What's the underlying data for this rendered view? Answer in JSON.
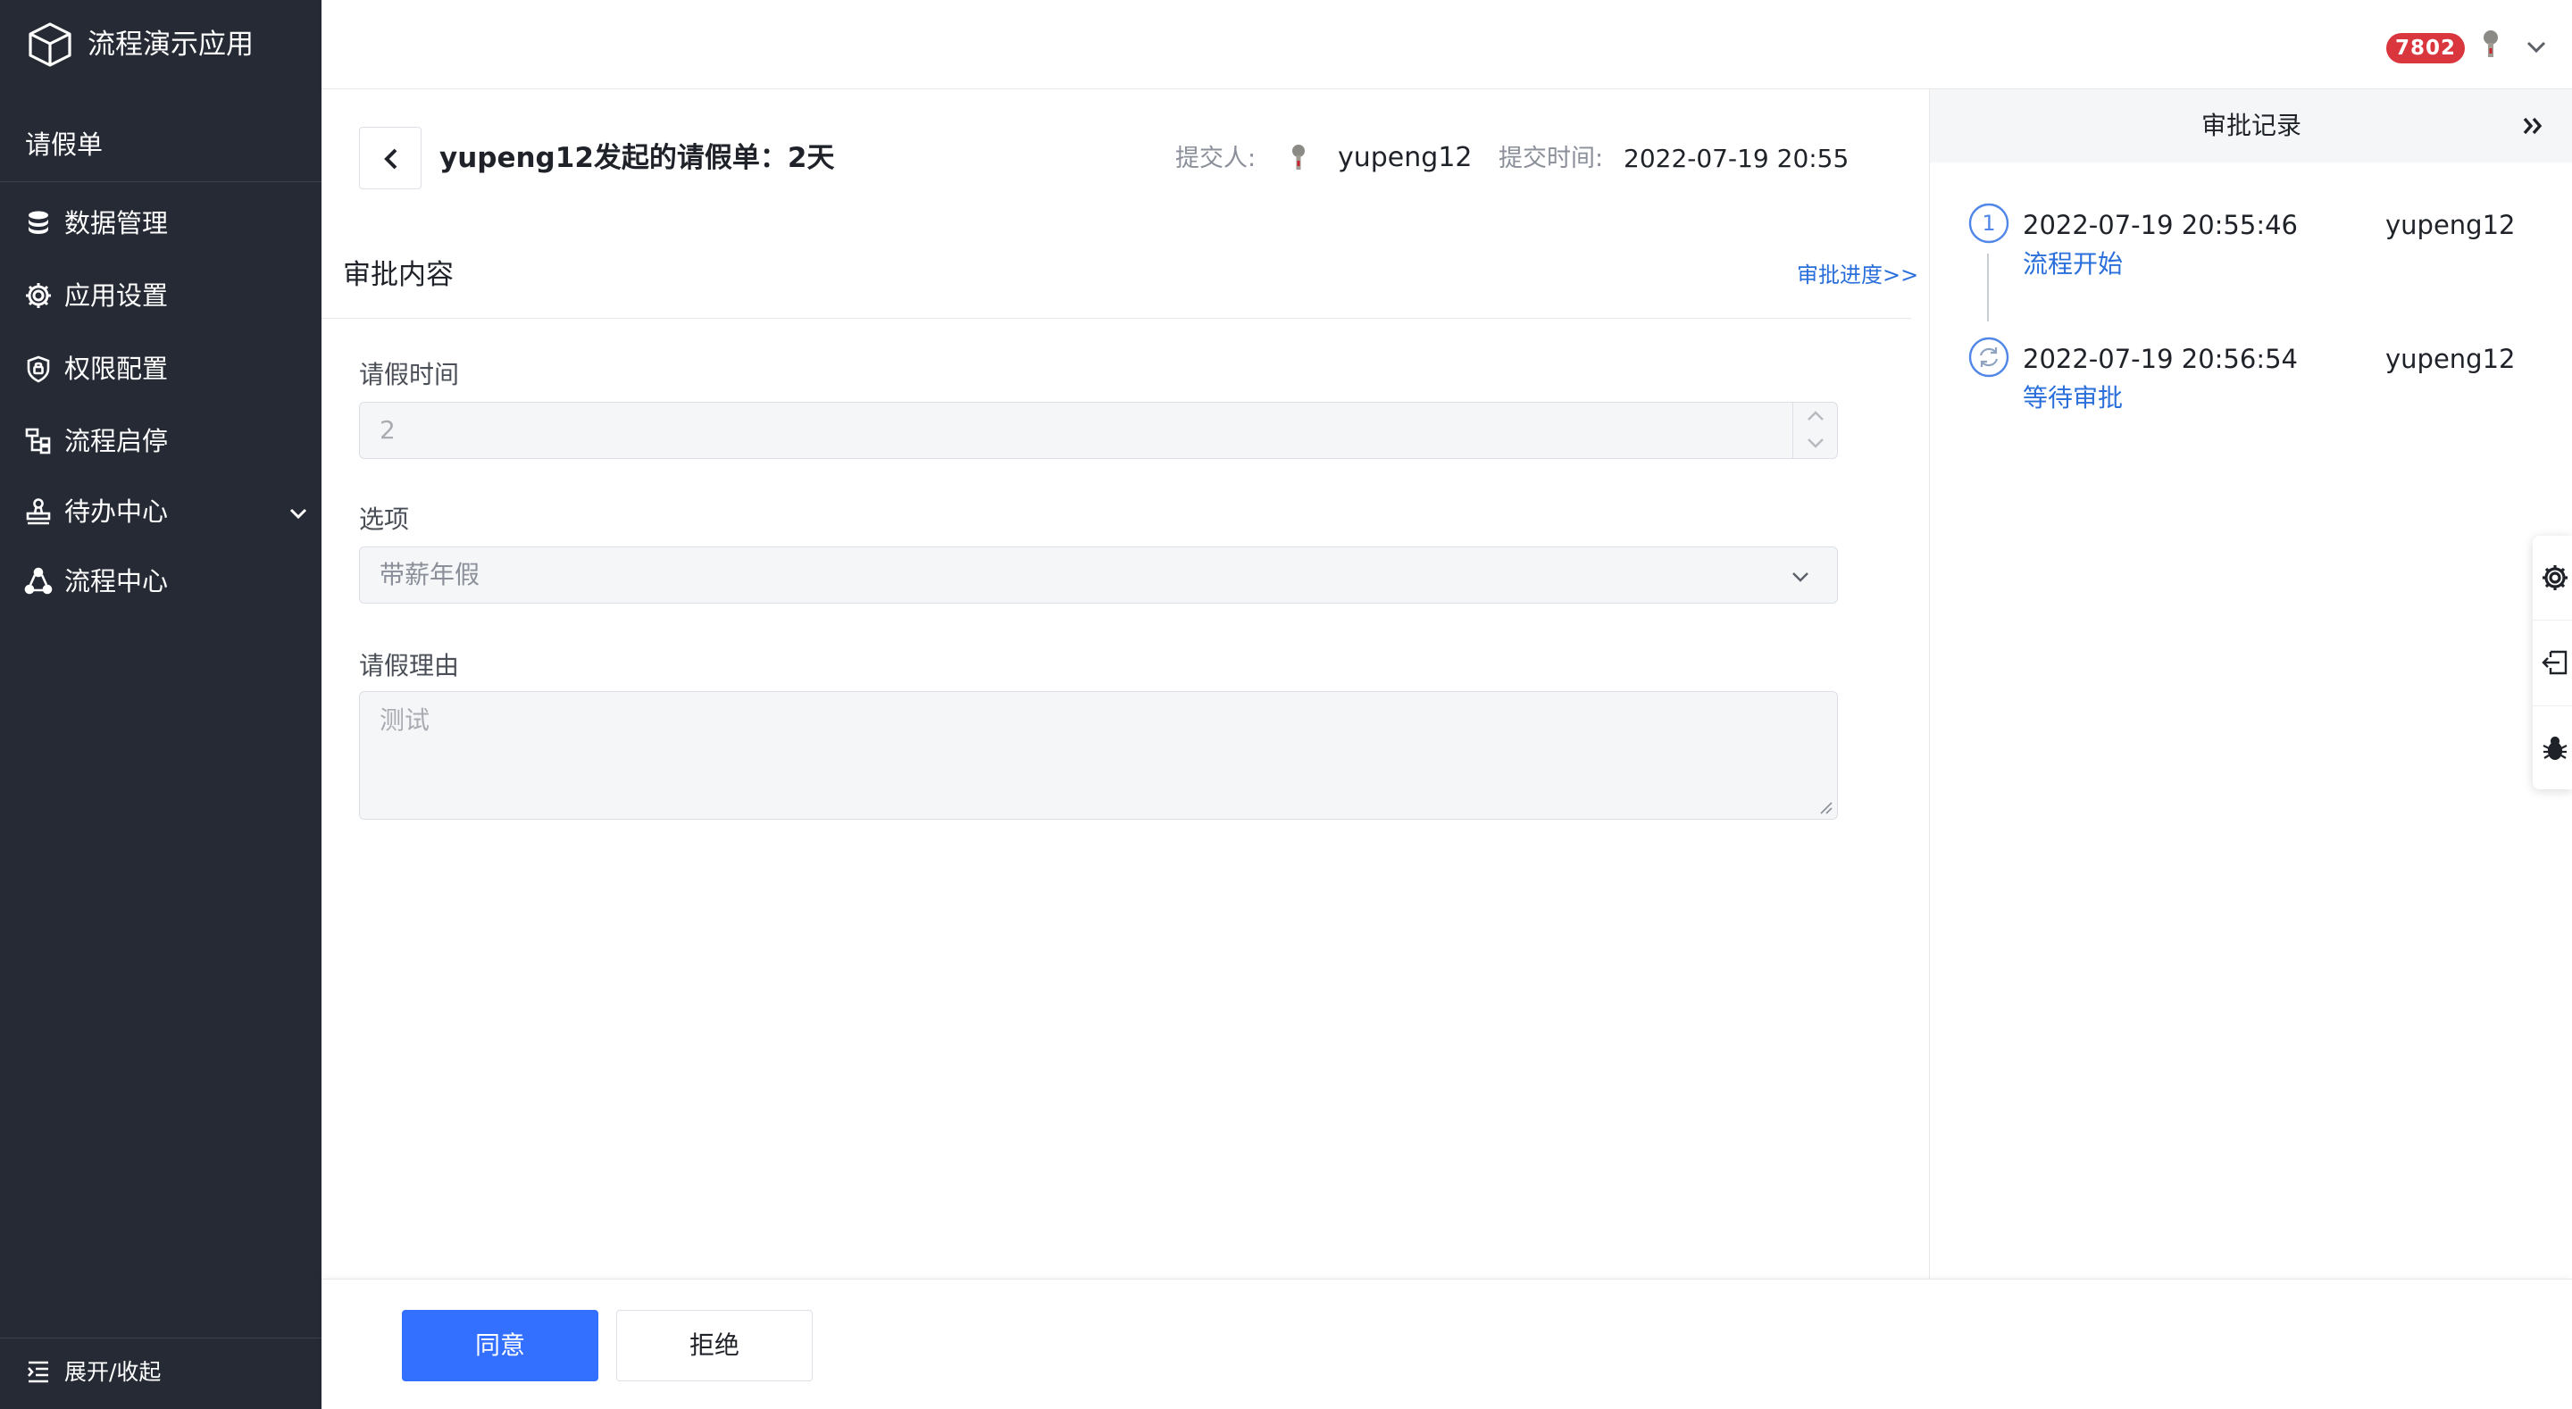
{
  "app": {
    "title": "流程演示应用",
    "icon": "cube-icon"
  },
  "sidebar": {
    "section": "请假单",
    "items": [
      {
        "label": "数据管理",
        "icon": "database-icon"
      },
      {
        "label": "应用设置",
        "icon": "gear-icon"
      },
      {
        "label": "权限配置",
        "icon": "shield-icon"
      },
      {
        "label": "流程启停",
        "icon": "flow-icon"
      },
      {
        "label": "待办中心",
        "icon": "stamp-icon",
        "expandable": true
      },
      {
        "label": "流程中心",
        "icon": "network-icon"
      }
    ],
    "footer": {
      "label": "展开/收起",
      "icon": "indent-icon"
    }
  },
  "topbar": {
    "badge": "7802",
    "badge_color": "#d9363e",
    "avatar_icon": "user-avatar-icon",
    "menu_icon": "chevron-down-icon"
  },
  "main": {
    "title": "yupeng12发起的请假单：2天",
    "meta": {
      "submitter_label": "提交人:",
      "submitter": "yupeng12",
      "time_label": "提交时间:",
      "time": "2022-07-19 20:55"
    },
    "section_title": "审批内容",
    "section_link": "审批进度>>",
    "fields": {
      "leave_time": {
        "label": "请假时间",
        "value": "2"
      },
      "option": {
        "label": "选项",
        "value": "带薪年假"
      },
      "reason": {
        "label": "请假理由",
        "value": "测试"
      }
    }
  },
  "record_panel": {
    "title": "审批记录",
    "entries": [
      {
        "step": "1",
        "time": "2022-07-19 20:55:46",
        "user": "yupeng12",
        "status": "流程开始"
      },
      {
        "time": "2022-07-19 20:56:54",
        "user": "yupeng12",
        "status": "等待审批",
        "icon": "refresh-icon"
      }
    ]
  },
  "side_tools": [
    {
      "icon": "gear-icon"
    },
    {
      "icon": "exit-icon"
    },
    {
      "icon": "bug-icon"
    }
  ],
  "actions": {
    "approve": "同意",
    "reject": "拒绝"
  },
  "colors": {
    "sidebar_bg": "#252a35",
    "primary": "#3370ff",
    "link": "#2a6fdb"
  }
}
